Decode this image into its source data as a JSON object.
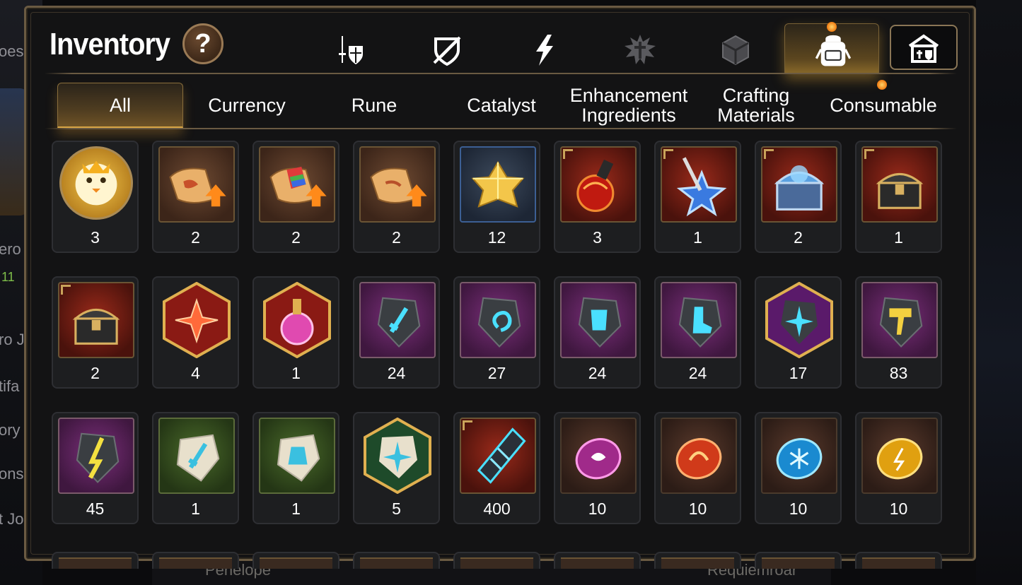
{
  "window": {
    "title": "Inventory",
    "help_label": "?"
  },
  "type_tabs": [
    {
      "icon": "sword-shield-icon",
      "active": false
    },
    {
      "icon": "broken-shield-icon",
      "active": false
    },
    {
      "icon": "lightning-icon",
      "active": false
    },
    {
      "icon": "splatter-cross-icon",
      "active": false
    },
    {
      "icon": "cube-icon",
      "active": false
    },
    {
      "icon": "backpack-icon",
      "active": true
    },
    {
      "icon": "storage-house-icon",
      "active": false
    }
  ],
  "categories": [
    {
      "label": "All",
      "active": true
    },
    {
      "label": "Currency",
      "active": false
    },
    {
      "label": "Rune",
      "active": false
    },
    {
      "label": "Catalyst",
      "active": false
    },
    {
      "label": "Enhancement Ingredients",
      "active": false
    },
    {
      "label": "Crafting Materials",
      "active": false
    },
    {
      "label": "Consumable",
      "active": false
    }
  ],
  "items": [
    {
      "icon": "chick-coin-icon",
      "qty": "3",
      "frame": "round"
    },
    {
      "icon": "scroll-upgrade-icon",
      "qty": "2",
      "frame": "brown"
    },
    {
      "icon": "scroll-rainbow-upgrade-icon",
      "qty": "2",
      "frame": "brown"
    },
    {
      "icon": "scroll-upgrade-icon",
      "qty": "2",
      "frame": "brown"
    },
    {
      "icon": "gold-crystal-cluster-icon",
      "qty": "12",
      "frame": "blue"
    },
    {
      "icon": "fire-potion-icon",
      "qty": "3",
      "frame": "red"
    },
    {
      "icon": "star-wand-icon",
      "qty": "1",
      "frame": "red"
    },
    {
      "icon": "blue-chest-icon",
      "qty": "2",
      "frame": "red"
    },
    {
      "icon": "gold-chest-icon",
      "qty": "1",
      "frame": "red"
    },
    {
      "icon": "gold-chest-icon",
      "qty": "2",
      "frame": "red"
    },
    {
      "icon": "red-star-rune-icon",
      "qty": "4",
      "frame": "hex-red"
    },
    {
      "icon": "pink-potion-icon",
      "qty": "1",
      "frame": "hex-red"
    },
    {
      "icon": "sword-rune-stone-icon",
      "qty": "24",
      "frame": "purple"
    },
    {
      "icon": "spiral-rune-stone-icon",
      "qty": "27",
      "frame": "purple"
    },
    {
      "icon": "armor-rune-stone-icon",
      "qty": "24",
      "frame": "purple"
    },
    {
      "icon": "boot-rune-stone-icon",
      "qty": "24",
      "frame": "purple"
    },
    {
      "icon": "star-rune-stone-icon",
      "qty": "17",
      "frame": "hex-purple"
    },
    {
      "icon": "hammer-rune-stone-icon",
      "qty": "83",
      "frame": "purple"
    },
    {
      "icon": "bolt-rune-stone-icon",
      "qty": "45",
      "frame": "purple"
    },
    {
      "icon": "sword-pebble-icon",
      "qty": "1",
      "frame": "green"
    },
    {
      "icon": "bell-pebble-icon",
      "qty": "1",
      "frame": "green"
    },
    {
      "icon": "star-pebble-icon",
      "qty": "5",
      "frame": "hex-green"
    },
    {
      "icon": "dark-crystal-icon",
      "qty": "400",
      "frame": "red"
    },
    {
      "icon": "purple-gem-icon",
      "qty": "10",
      "frame": "dbrown"
    },
    {
      "icon": "red-gem-icon",
      "qty": "10",
      "frame": "dbrown"
    },
    {
      "icon": "blue-gem-icon",
      "qty": "10",
      "frame": "dbrown"
    },
    {
      "icon": "yellow-gem-icon",
      "qty": "10",
      "frame": "dbrown"
    }
  ],
  "background": {
    "left_fragments": [
      "oes",
      "ero",
      "11",
      "ro J",
      "tifa",
      "ory",
      "ons",
      "t Jo"
    ],
    "bottom_names": [
      "Penelope",
      "Requiemroar"
    ]
  },
  "colors": {
    "accent": "#d9a646",
    "panel_border": "#6a5a42",
    "notification": "#f07a10"
  }
}
